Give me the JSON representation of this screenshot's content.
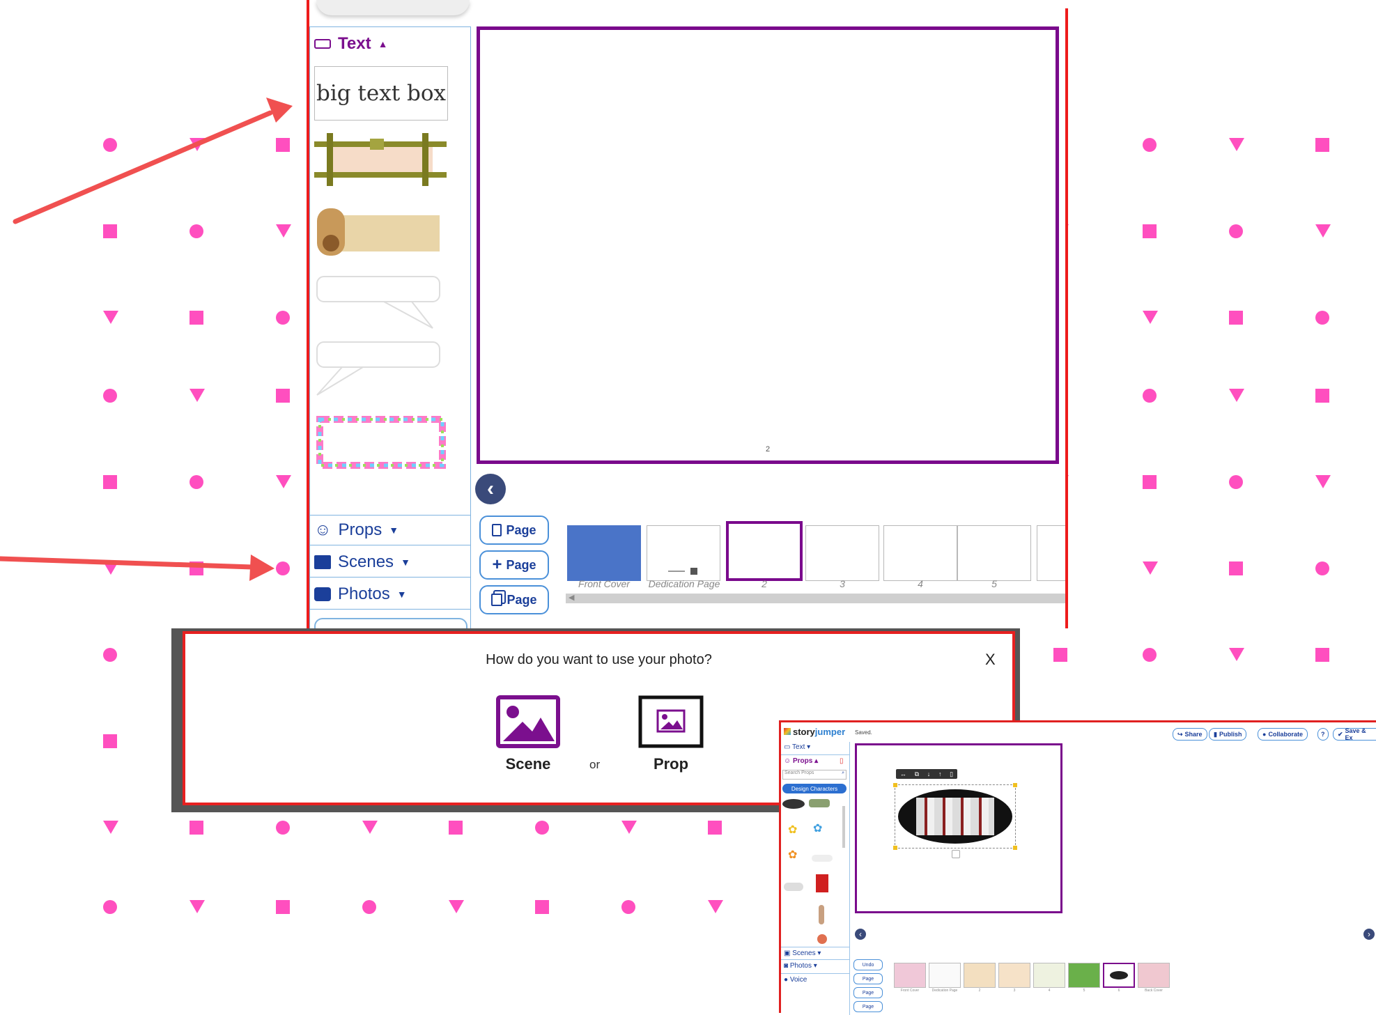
{
  "colors": {
    "pattern_pink": "#ff4fbf",
    "arrow_red": "#f05050",
    "editor_blue": "#1b3f9a",
    "canvas_purple": "#7a0a8c",
    "text_purple": "#7b0f8e",
    "frame_red": "#ee1c1c"
  },
  "editor": {
    "text_section_label": "Text",
    "big_text_box_label": "big text box",
    "props_label": "Props",
    "scenes_label": "Scenes",
    "photos_label": "Photos",
    "page_number": "2",
    "page_buttons": [
      "Page",
      "Page",
      "Page"
    ],
    "thumbnails": [
      {
        "label": "Front Cover"
      },
      {
        "label": "Dedication Page"
      },
      {
        "label": "2"
      },
      {
        "label": "3"
      },
      {
        "label": "4"
      },
      {
        "label": "5"
      }
    ]
  },
  "dialog": {
    "question": "How do you want to use your photo?",
    "close_label": "X",
    "scene_label": "Scene",
    "or_label": "or",
    "prop_label": "Prop"
  },
  "inset": {
    "logo_story": "story",
    "logo_jumper": "jumper",
    "saved_text": "Saved.",
    "toolbar": [
      "Share",
      "Publish",
      "Collaborate",
      "?",
      "Save & Ex"
    ],
    "text_label": "Text",
    "props_label": "Props",
    "search_placeholder": "Search Props",
    "design_characters_label": "Design Characters",
    "scenes_label": "Scenes",
    "photos_label": "Photos",
    "voice_label": "Voice",
    "undo_label": "Undo",
    "page_label": "Page",
    "thumb_labels": [
      "Front Cover",
      "Dedication Page",
      "2",
      "3",
      "4",
      "5",
      "6",
      "Back Cover"
    ]
  }
}
